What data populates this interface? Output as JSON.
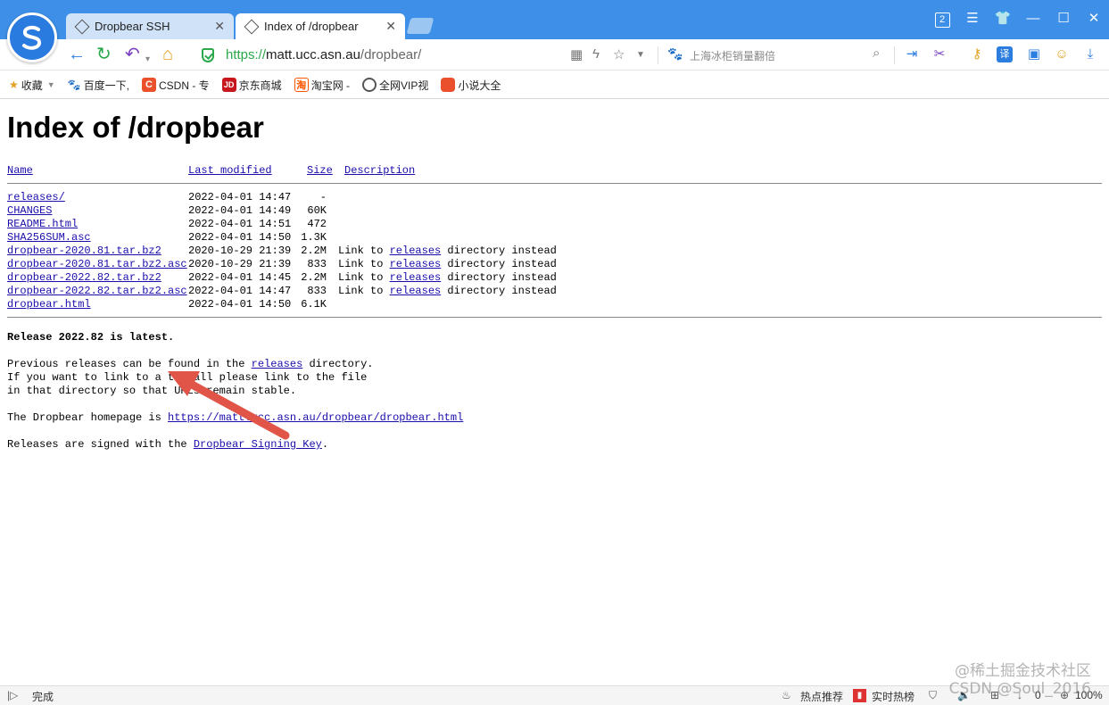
{
  "browser": {
    "tabs": [
      {
        "label": "Dropbear SSH",
        "active": false
      },
      {
        "label": "Index of /dropbear",
        "active": true
      }
    ],
    "window_badge": "2",
    "url": {
      "scheme": "https://",
      "host": "matt.ucc.asn.au",
      "path": "/dropbear/"
    },
    "search_placeholder": "上海冰柜销量翻倍",
    "bookmarks": [
      "收藏",
      "百度一下,",
      "CSDN - 专",
      "京东商城",
      "淘宝网 -",
      "全网VIP视",
      "小说大全"
    ],
    "bookmark_icons": [
      "C",
      "JD",
      "淘"
    ]
  },
  "page": {
    "title": "Index of /dropbear",
    "columns": [
      "Name",
      "Last modified",
      "Size",
      "Description"
    ],
    "rows": [
      {
        "name": "releases/",
        "modified": "2022-04-01 14:47",
        "size": "-",
        "desc": ""
      },
      {
        "name": "CHANGES",
        "modified": "2022-04-01 14:49",
        "size": "60K",
        "desc": ""
      },
      {
        "name": "README.html",
        "modified": "2022-04-01 14:51",
        "size": "472",
        "desc": ""
      },
      {
        "name": "SHA256SUM.asc",
        "modified": "2022-04-01 14:50",
        "size": "1.3K",
        "desc": ""
      },
      {
        "name": "dropbear-2020.81.tar.bz2",
        "modified": "2020-10-29 21:39",
        "size": "2.2M",
        "desc": "releases"
      },
      {
        "name": "dropbear-2020.81.tar.bz2.asc",
        "modified": "2020-10-29 21:39",
        "size": "833",
        "desc": "releases"
      },
      {
        "name": "dropbear-2022.82.tar.bz2",
        "modified": "2022-04-01 14:45",
        "size": "2.2M",
        "desc": "releases"
      },
      {
        "name": "dropbear-2022.82.tar.bz2.asc",
        "modified": "2022-04-01 14:47",
        "size": "833",
        "desc": "releases"
      },
      {
        "name": "dropbear.html",
        "modified": "2022-04-01 14:50",
        "size": "6.1K",
        "desc": ""
      }
    ],
    "desc_prefix": "Link to ",
    "desc_suffix": " directory instead",
    "latest": "Release 2022.82 is latest.",
    "prev_text_1": "Previous releases can be found in the ",
    "prev_link": "releases",
    "prev_text_2": " directory.",
    "prev_line2": "If you want to link to a tarball please link to the file",
    "prev_line3": "in that directory so that URLs remain stable.",
    "homepage_text": "The Dropbear homepage is ",
    "homepage_link": "https://matt.ucc.asn.au/dropbear/dropbear.html",
    "signed_text": "Releases are signed with the ",
    "signed_link": "Dropbear Signing Key",
    "signed_end": "."
  },
  "status": {
    "left": "完成",
    "hot": "热点推荐",
    "realtime": "实时热榜",
    "zoom": "100%",
    "counter": "0"
  },
  "watermark": {
    "line1": "@稀土掘金技术社区",
    "line2": "CSDN @Soul_2016"
  },
  "colors": {
    "titlebar": "#3d8fe8",
    "link": "#1a0dab",
    "arrow": "#e05548"
  }
}
